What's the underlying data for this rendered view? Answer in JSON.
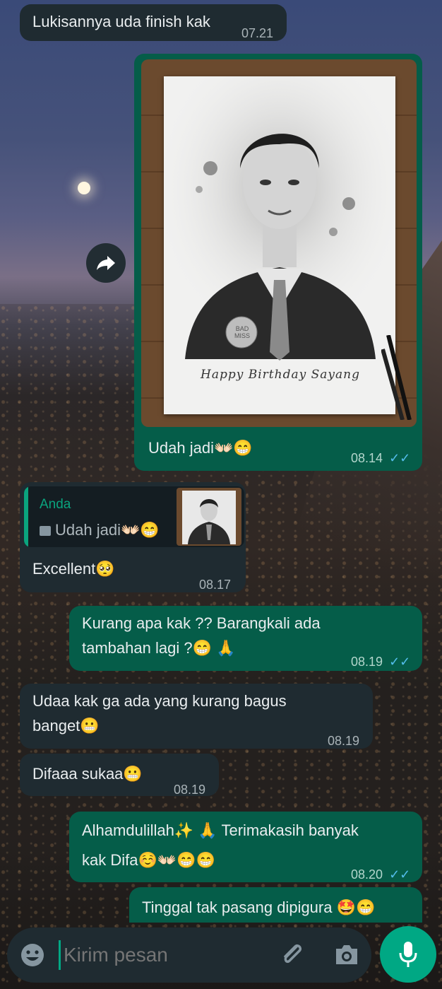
{
  "messages": {
    "m1": {
      "text": "Lukisannya uda finish kak",
      "time": "07.21"
    },
    "m2": {
      "caption": "Udah jadi👐🏻😁",
      "time": "08.14",
      "ticks": "✓✓",
      "artwork_text": "Happy Birthday Sayang",
      "badge_text": "BAD MISS"
    },
    "m3": {
      "quote_author": "Anda",
      "quote_text": "Udah jadi👐🏻😁",
      "quote_icon": "image-icon",
      "text": "Excellent🥺",
      "time": "08.17"
    },
    "m4": {
      "line1": "Kurang apa kak ?? Barangkali ada",
      "line2": "tambahan lagi ?😁 🙏",
      "time": "08.19",
      "ticks": "✓✓"
    },
    "m5": {
      "line1": "Udaa kak ga ada yang kurang bagus",
      "line2": "banget😬",
      "time": "08.19"
    },
    "m6": {
      "text": "Difaaa sukaa😬",
      "time": "08.19"
    },
    "m7": {
      "line1": "Alhamdulillah✨ 🙏  Terimakasih banyak",
      "line2": "kak Difa☺️👐🏻😁😁",
      "time": "08.20",
      "ticks": "✓✓"
    },
    "m8": {
      "text": "Tinggal tak pasang dipigura 🤩😁"
    }
  },
  "input": {
    "placeholder": "Kirim pesan"
  },
  "icons": {
    "emoji": "emoji-icon",
    "attach": "paperclip-icon",
    "camera": "camera-icon",
    "mic": "microphone-icon",
    "forward": "forward-icon"
  },
  "colors": {
    "outgoing": "#055d49",
    "incoming": "#1f2b31",
    "accent": "#00a884",
    "ticks": "#53bdeb"
  }
}
